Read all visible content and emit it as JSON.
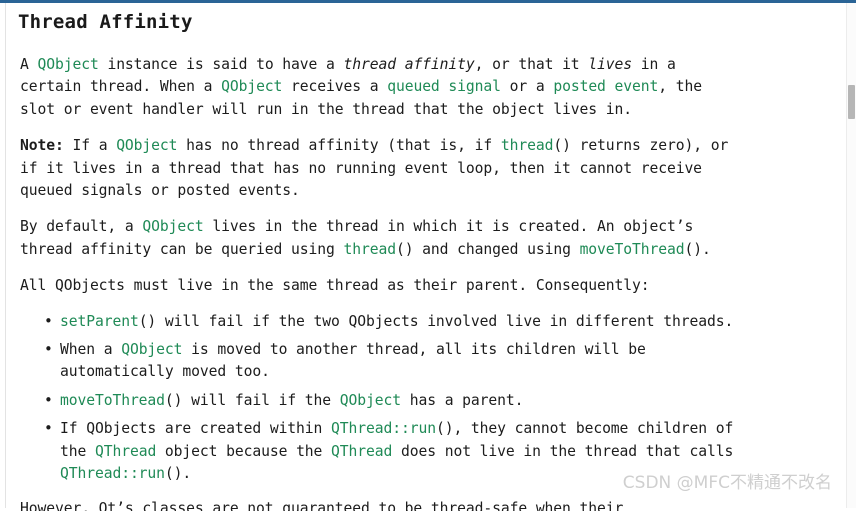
{
  "window": {
    "accent_color": "#2a6496",
    "link_color": "#1f8a56",
    "text_color": "#1c1c1c",
    "background_color": "#ffffff"
  },
  "doc": {
    "title": "Thread Affinity"
  },
  "paragraphs": {
    "intro": {
      "s1": "A ",
      "link1": "QObject",
      "s2": " instance is said to have a ",
      "em1": "thread affinity",
      "s3": ", or that it ",
      "em2": "lives",
      "s4": " in a\ncertain thread. When a ",
      "link2": "QObject",
      "s5": " receives a ",
      "link3": "queued signal",
      "s6": " or a ",
      "link4": "posted event",
      "s7": ", the\nslot or event handler will run in the thread that the object lives in."
    },
    "note": {
      "bold1": "Note:",
      "s1": " If a ",
      "link1": "QObject",
      "s2": " has no thread affinity (that is, if ",
      "link2": "thread",
      "s3": "() returns zero), or\nif it lives in a thread that has no running event loop, then it cannot receive\nqueued signals or posted events."
    },
    "bydefault": {
      "s1": "By default, a ",
      "link1": "QObject",
      "s2": " lives in the thread in which it is created. An object’s\nthread affinity can be queried using ",
      "link2": "thread",
      "s3": "() and changed using ",
      "link3": "moveToThread",
      "s4": "()."
    },
    "allqobjects": {
      "s1": "All QObjects must live in the same thread as their parent. Consequently:"
    }
  },
  "bullets": [
    {
      "link1": "setParent",
      "s1": "() will fail if the two QObjects involved live in different threads."
    },
    {
      "s0": "When a ",
      "link1": "QObject",
      "s1": " is moved to another thread, all its children will be\nautomatically moved too."
    },
    {
      "link1": "moveToThread",
      "s1": "() will fail if the ",
      "link2": "QObject",
      "s2": " has a parent."
    },
    {
      "s0": "If QObjects are created within ",
      "link1": "QThread::run",
      "s1": "(), they cannot become children of\nthe ",
      "link2": "QThread",
      "s2": " object because the ",
      "link3": "QThread",
      "s3": " does not live in the thread that calls\n",
      "link4": "QThread::run",
      "s4": "()."
    }
  ],
  "cut_off_line": {
    "text": "However, Qt’s classes are not guaranteed to be thread-safe when their"
  },
  "watermark": {
    "text": "CSDN @MFC不精通不改名"
  },
  "scrollbar": {
    "thumb_label": "vertical-scroll-thumb"
  }
}
